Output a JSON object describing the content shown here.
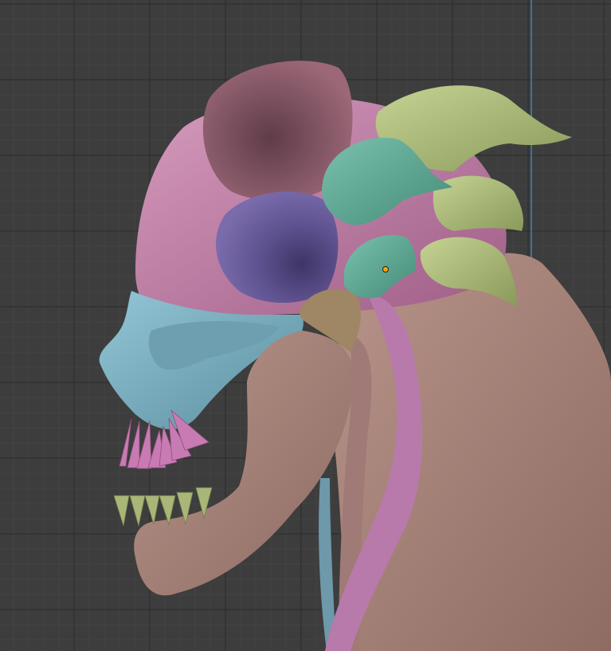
{
  "viewport": {
    "background": "#3d3d3d",
    "grid_minor_color": "#454545",
    "grid_major_color": "#2f2f2f",
    "axis_color": "#4a7fb8"
  },
  "model": {
    "colors": {
      "cranium": "#c07ea4",
      "crest": "#8f5a6a",
      "eye_socket": "#6a5a96",
      "snout": "#79afc0",
      "jaw": "#a98476",
      "neck": "#a98476",
      "tube": "#b87aab",
      "horn_green": "#a8b678",
      "horn_teal": "#5fa792",
      "cheek_spike": "#9f8664",
      "upper_teeth": "#c87bb2",
      "lower_teeth": "#a8b678",
      "origin_point": "#ffa500"
    }
  }
}
